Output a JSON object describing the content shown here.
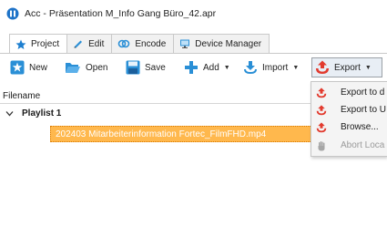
{
  "window": {
    "title": "Acc - Präsentation M_Info Gang Büro_42.apr"
  },
  "tabs": [
    {
      "label": "Project",
      "icon": "star-icon"
    },
    {
      "label": "Edit",
      "icon": "pencil-icon"
    },
    {
      "label": "Encode",
      "icon": "encode-icon"
    },
    {
      "label": "Device Manager",
      "icon": "monitor-icon"
    }
  ],
  "toolbar": {
    "new_label": "New",
    "open_label": "Open",
    "save_label": "Save",
    "add_label": "Add",
    "import_label": "Import",
    "export_label": "Export"
  },
  "file_list": {
    "header": "Filename",
    "playlist_label": "Playlist 1",
    "selected_file": "202403 Mitarbeiterinformation Fortec_FilmFHD.mp4"
  },
  "export_menu": {
    "items": [
      {
        "label": "Export to d",
        "icon": "export-icon",
        "enabled": true
      },
      {
        "label": "Export to U",
        "icon": "export-icon",
        "enabled": true
      },
      {
        "label": "Browse...",
        "icon": "export-icon",
        "enabled": true
      },
      {
        "label": "Abort Loca",
        "icon": "hand-icon",
        "enabled": false
      }
    ]
  },
  "colors": {
    "selection": "#ffb84d",
    "export_red": "#e23a2e",
    "toolbar_blue": "#2a8fd6"
  }
}
